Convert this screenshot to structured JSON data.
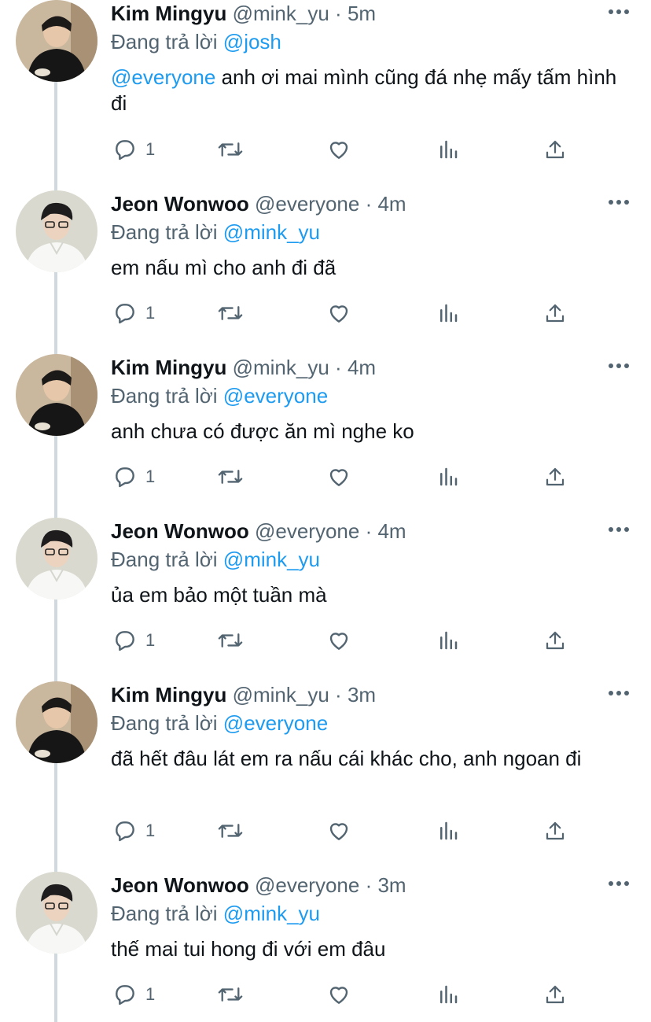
{
  "labels": {
    "reply_prefix": "Đang trả lời",
    "dot": "·"
  },
  "users": {
    "mingyu": {
      "name": "Kim Mingyu",
      "handle": "@mink_yu"
    },
    "wonwoo": {
      "name": "Jeon Wonwoo",
      "handle": "@everyone"
    }
  },
  "tweets": [
    {
      "name": "Kim Mingyu",
      "handle": "@mink_yu",
      "time": "5m",
      "replying_to": "@josh",
      "text_mention": "@everyone",
      "text": " anh ơi mai mình cũng đá nhẹ mấy tấm hình đi",
      "reply_count": "1"
    },
    {
      "name": "Jeon Wonwoo",
      "handle": "@everyone",
      "time": "4m",
      "replying_to": "@mink_yu",
      "text_mention": "",
      "text": "em nấu mì cho anh đi đã",
      "reply_count": "1"
    },
    {
      "name": "Kim Mingyu",
      "handle": "@mink_yu",
      "time": "4m",
      "replying_to": "@everyone",
      "text_mention": "",
      "text": "anh chưa có được ăn mì nghe ko",
      "reply_count": "1"
    },
    {
      "name": "Jeon Wonwoo",
      "handle": "@everyone",
      "time": "4m",
      "replying_to": "@mink_yu",
      "text_mention": "",
      "text": "ủa em bảo một tuần mà",
      "reply_count": "1"
    },
    {
      "name": "Kim Mingyu",
      "handle": "@mink_yu",
      "time": "3m",
      "replying_to": "@everyone",
      "text_mention": "",
      "text": "đã hết đâu lát em ra nấu cái khác cho, anh ngoan đi",
      "reply_count": "1"
    },
    {
      "name": "Jeon Wonwoo",
      "handle": "@everyone",
      "time": "3m",
      "replying_to": "@mink_yu",
      "text_mention": "",
      "text": "thế mai tui hong đi với em đâu",
      "reply_count": "1"
    }
  ],
  "icons": {
    "reply": "reply-icon",
    "retweet": "retweet-icon",
    "like": "heart-icon",
    "analytics": "analytics-icon",
    "share": "share-icon",
    "more": "more-icon"
  },
  "colors": {
    "link": "#1d9bf0",
    "secondary": "#536471",
    "text": "#0f1419",
    "thread_line": "#cfd9de"
  }
}
